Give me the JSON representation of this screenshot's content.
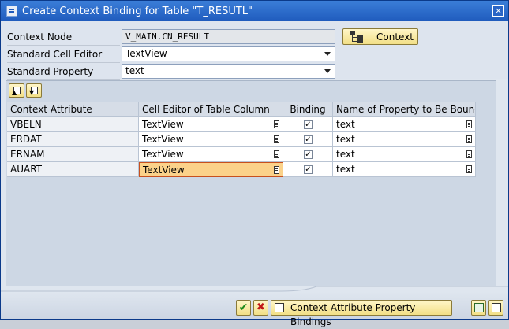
{
  "window": {
    "title": "Create Context Binding for Table \"T_RESUTL\"",
    "close_glyph": "×"
  },
  "form": {
    "context_node_label": "Context Node",
    "context_node_value": "V_MAIN.CN_RESULT",
    "context_button_label": "Context",
    "standard_cell_editor_label": "Standard Cell Editor",
    "standard_cell_editor_value": "TextView",
    "standard_property_label": "Standard Property",
    "standard_property_value": "text"
  },
  "table": {
    "columns": [
      "Context Attribute",
      "Cell Editor of Table Column",
      "Binding",
      "Name of Property to Be Bound"
    ],
    "rows": [
      {
        "attribute": "VBELN",
        "cell_editor": "TextView",
        "binding": true,
        "property": "text"
      },
      {
        "attribute": "ERDAT",
        "cell_editor": "TextView",
        "binding": true,
        "property": "text"
      },
      {
        "attribute": "ERNAM",
        "cell_editor": "TextView",
        "binding": true,
        "property": "text"
      },
      {
        "attribute": "AUART",
        "cell_editor": "TextView",
        "binding": true,
        "property": "text"
      }
    ],
    "check_glyph": "✓"
  },
  "footer": {
    "ok_glyph": "✔",
    "cancel_glyph": "✖",
    "property_bindings_label": "Context Attribute Property Bindings"
  },
  "icons": [
    "window-icon",
    "close-icon",
    "tree-icon",
    "insert-row-icon",
    "append-row-icon",
    "lookup-icon",
    "checkmark-icon",
    "cancel-icon",
    "bindings-icon",
    "layout-icon",
    "window-menu-icon"
  ],
  "colors": {
    "title_bar": "#1f5bbd",
    "button": "#f2df86",
    "active_cell": "#fbd28a",
    "active_border": "#c7501e"
  }
}
